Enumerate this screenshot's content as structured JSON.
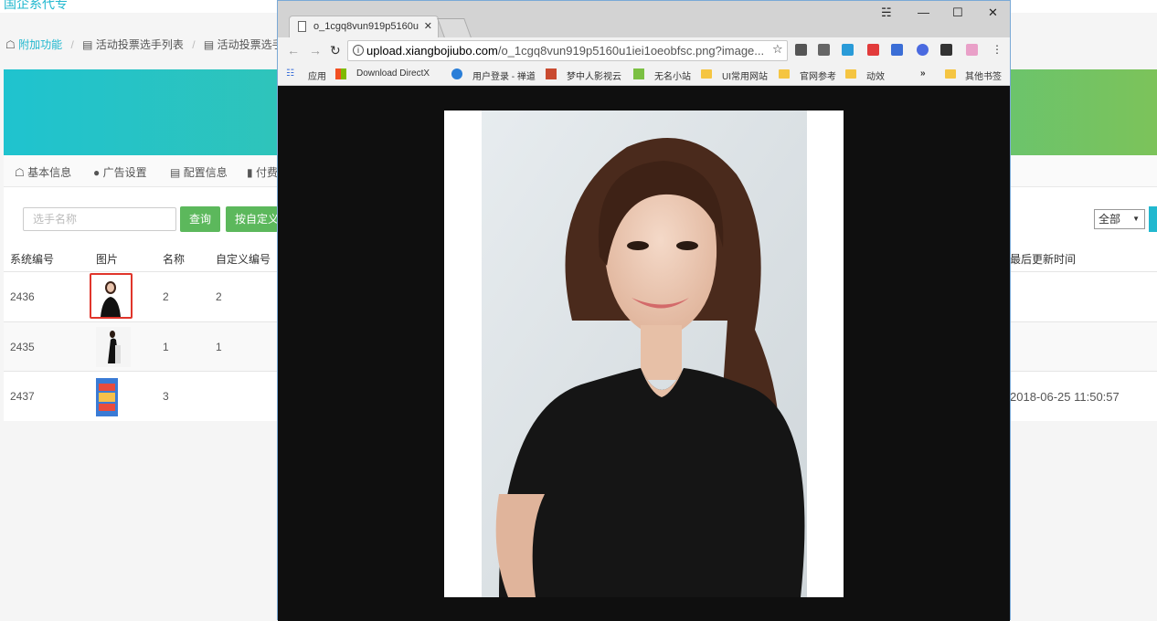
{
  "page": {
    "header_text": "国企系代专",
    "breadcrumb": [
      "附加功能",
      "活动投票选手列表",
      "活动投票选手"
    ],
    "tabs": [
      "基本信息",
      "广告设置",
      "配置信息",
      "付费"
    ],
    "search": {
      "placeholder": "选手名称",
      "query_label": "查询",
      "custom_label": "按自定义"
    },
    "filter": {
      "selected": "全部"
    },
    "table": {
      "headers": [
        "系统编号",
        "图片",
        "名称",
        "自定义编号",
        "最后更新时间"
      ],
      "rows": [
        {
          "id": "2436",
          "name": "2",
          "custom": "2",
          "updated": ""
        },
        {
          "id": "2435",
          "name": "1",
          "custom": "1",
          "updated": ""
        },
        {
          "id": "2437",
          "name": "3",
          "custom": "",
          "updated": "2018-06-25 11:50:57"
        }
      ]
    }
  },
  "popup": {
    "tab_title": "o_1cgq8vun919p5160u",
    "url_host": "upload.xiangbojiubo.com",
    "url_path": "/o_1cgq8vun919p5160u1iei1oeobfsc.png?image...",
    "bookmarks": [
      "应用",
      "Download DirectX",
      "用户登录 - 禅道",
      "梦中人影视云",
      "无名小站",
      "UI常用网站",
      "官网参考",
      "动效",
      "其他书签"
    ],
    "colors": {
      "accent": "#22b8cf",
      "green": "#5cb85c",
      "selection": "#e0352b"
    }
  }
}
